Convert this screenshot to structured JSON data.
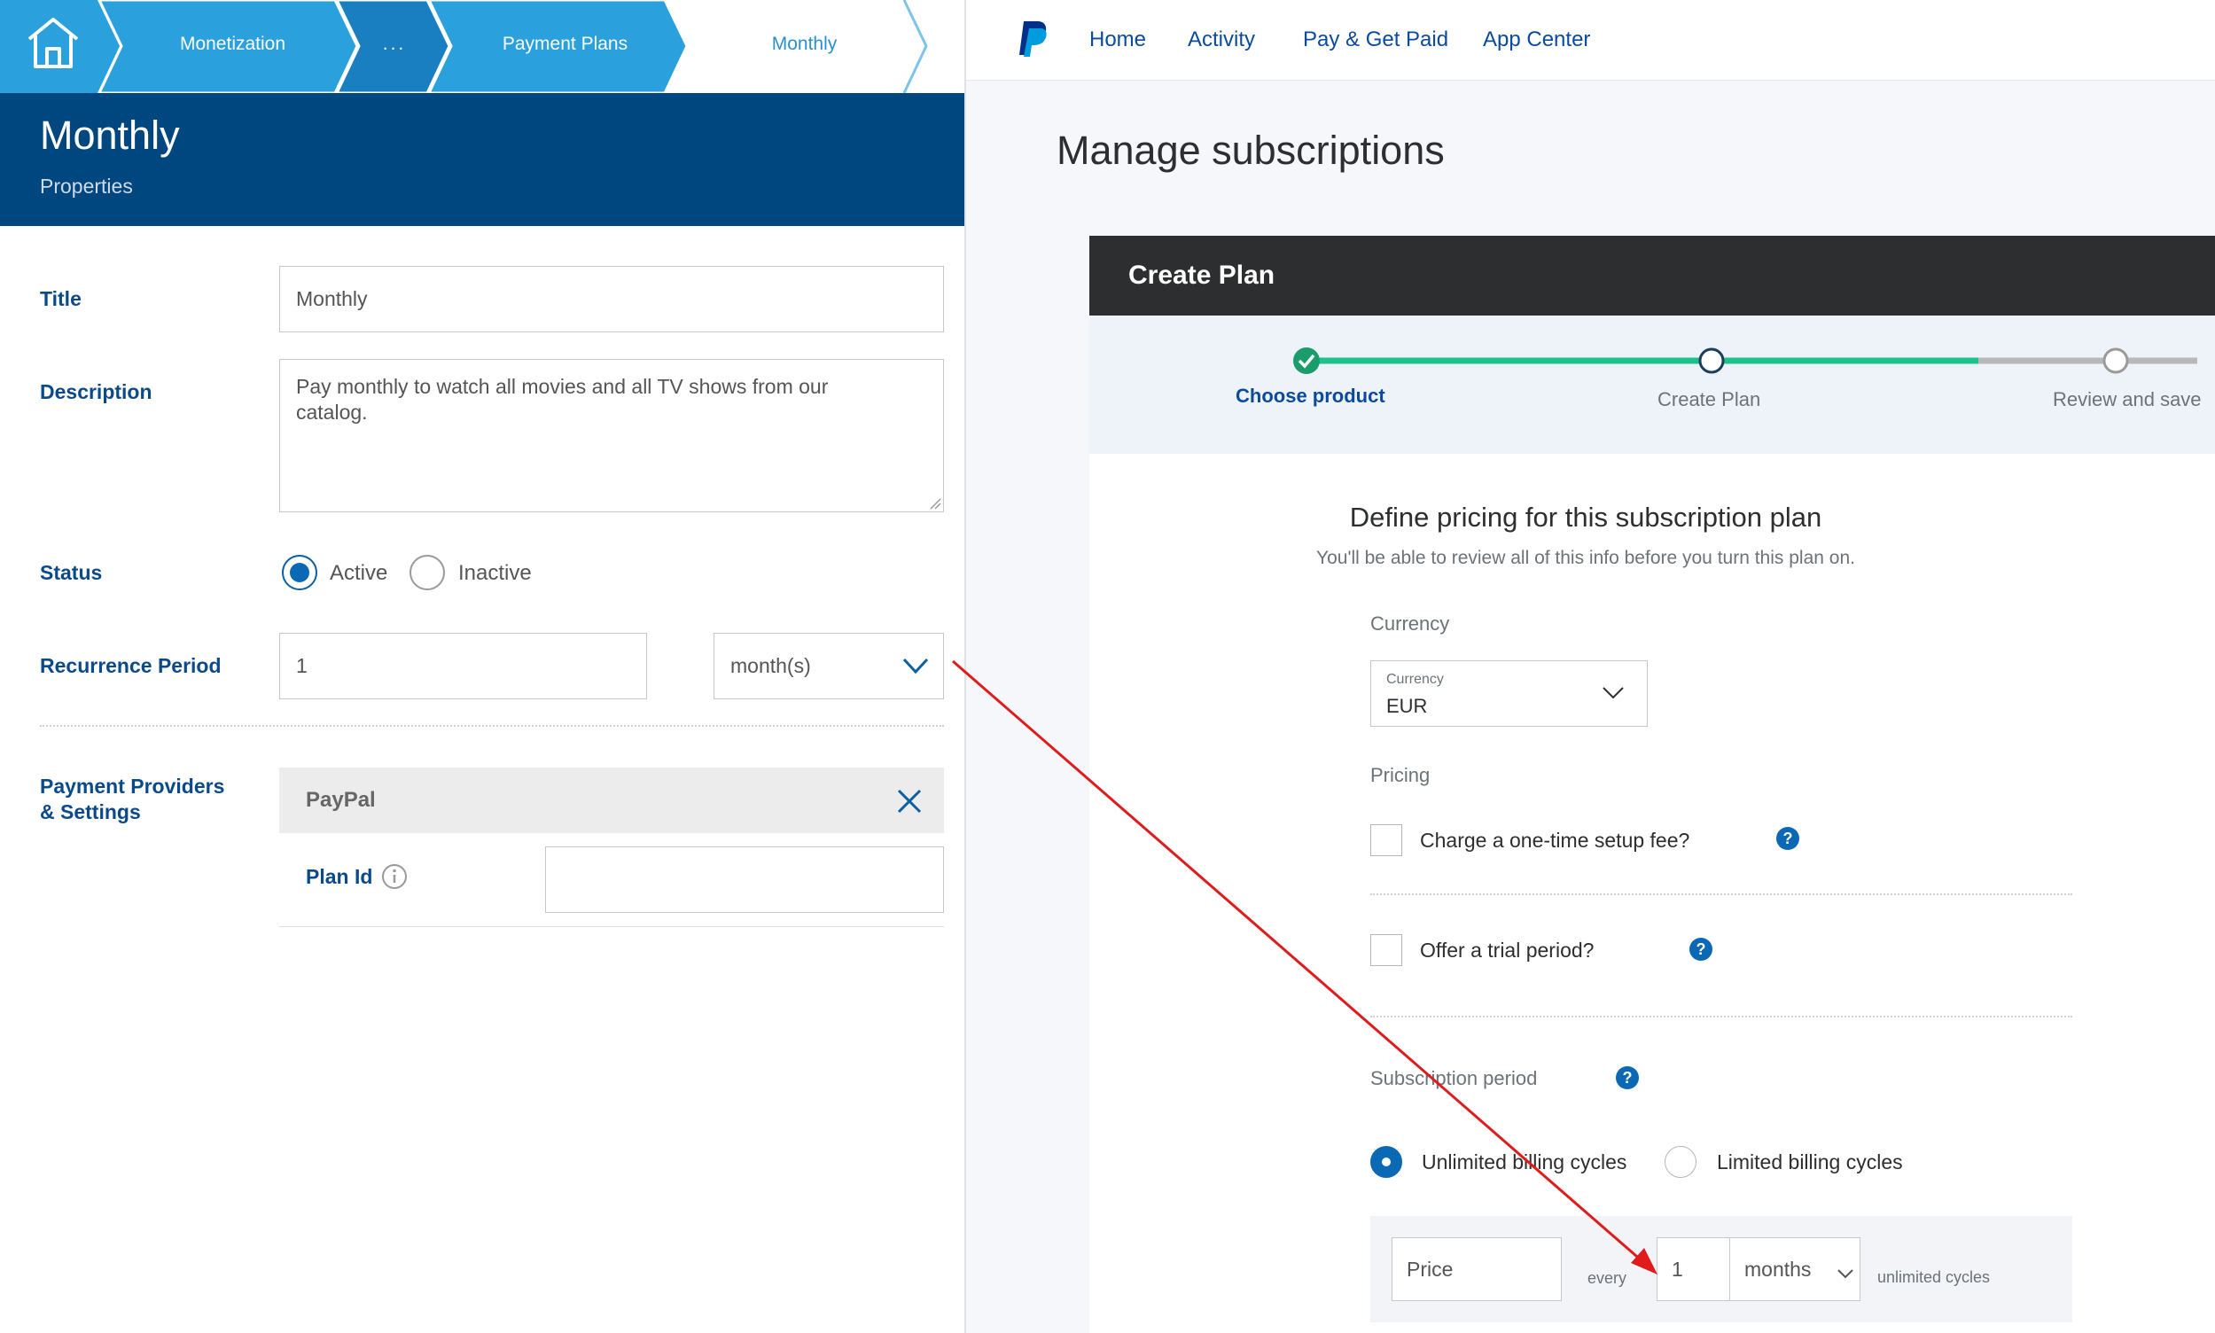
{
  "breadcrumb": {
    "items": [
      "Monetization",
      "...",
      "Payment Plans",
      "Monthly"
    ]
  },
  "header": {
    "title": "Monthly",
    "subtitle": "Properties"
  },
  "form": {
    "title_label": "Title",
    "title_value": "Monthly",
    "description_label": "Description",
    "description_value": "Pay monthly to watch all movies and all TV shows from our catalog.",
    "status_label": "Status",
    "status_active": "Active",
    "status_inactive": "Inactive",
    "recurrence_label": "Recurrence Period",
    "recurrence_value": "1",
    "recurrence_unit": "month(s)",
    "providers_label_1": "Payment Providers",
    "providers_label_2": "& Settings",
    "provider_name": "PayPal",
    "plan_id_label": "Plan Id",
    "plan_id_value": ""
  },
  "paypal": {
    "nav": [
      "Home",
      "Activity",
      "Pay & Get Paid",
      "App Center"
    ],
    "page_title": "Manage subscriptions",
    "panel_title": "Create Plan",
    "steps": [
      "Choose product",
      "Create Plan",
      "Review and save"
    ],
    "section_title": "Define pricing for this subscription plan",
    "section_sub": "You'll be able to review all of this info before you turn this plan on.",
    "currency_heading": "Currency",
    "currency_label": "Currency",
    "currency_value": "EUR",
    "pricing_heading": "Pricing",
    "setup_fee": "Charge a one-time setup fee?",
    "trial": "Offer a trial period?",
    "period_heading": "Subscription period",
    "unlimited": "Unlimited billing cycles",
    "limited": "Limited billing cycles",
    "price_placeholder": "Price",
    "every": "every",
    "interval_value": "1",
    "interval_unit": "months",
    "cycles": "unlimited cycles"
  },
  "colors": {
    "crumb_light": "#2aa0dc",
    "crumb_dark": "#1a7fc1",
    "header_blue": "#00467f",
    "label_blue": "#0b4a8a",
    "paypal_green": "#1cc28a",
    "annotation_red": "#e01b1b"
  }
}
